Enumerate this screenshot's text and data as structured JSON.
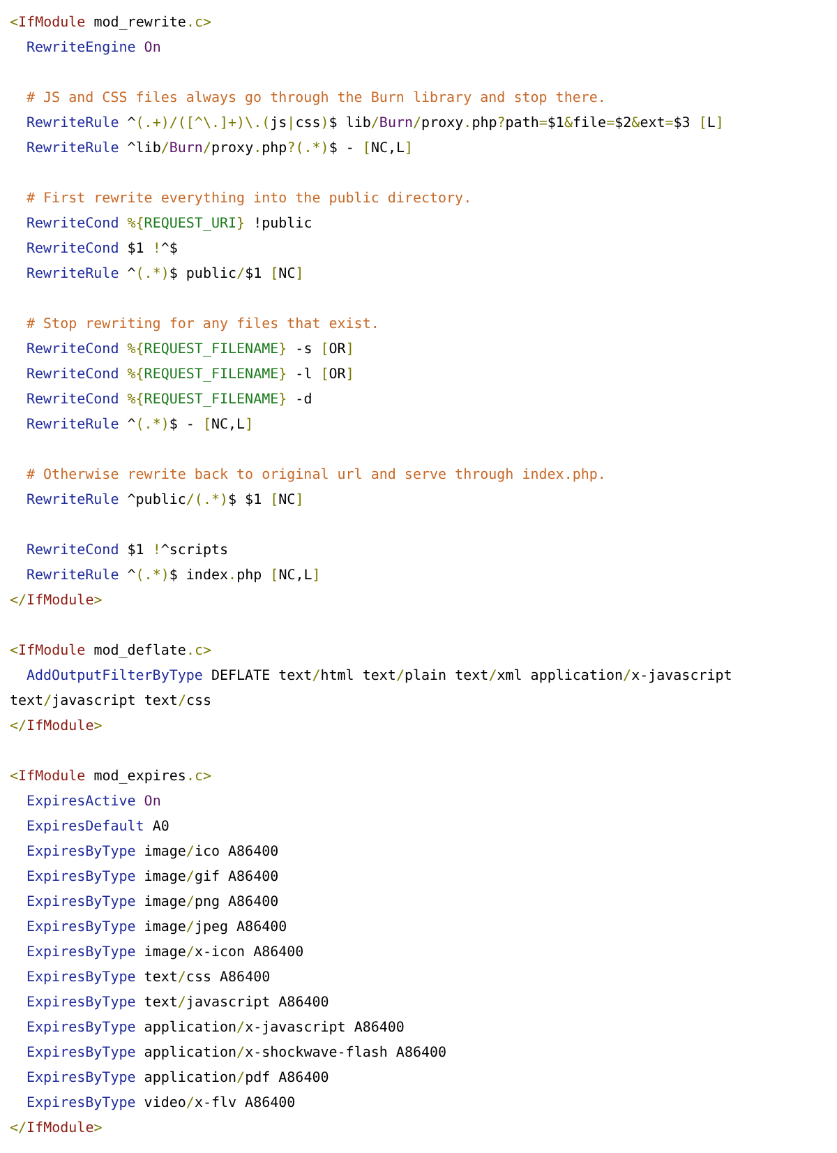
{
  "blocks": [
    {
      "open": [
        {
          "kind": "op",
          "text": "<"
        },
        {
          "kind": "tag",
          "text": "IfModule"
        },
        {
          "kind": "txt",
          "text": " mod_rewrite"
        },
        {
          "kind": "op",
          "text": ".c>"
        }
      ],
      "groups": [
        [
          [
            {
              "kind": "dir",
              "text": "RewriteEngine "
            },
            {
              "kind": "kw",
              "text": "On"
            }
          ]
        ],
        [
          [
            {
              "kind": "cmt",
              "text": "# JS and CSS files always go through the Burn library and stop there."
            }
          ],
          [
            {
              "kind": "dir",
              "text": "RewriteRule"
            },
            {
              "kind": "txt",
              "text": " ^"
            },
            {
              "kind": "op",
              "text": "(.+)/([^\\.]+)\\.("
            },
            {
              "kind": "txt",
              "text": "js"
            },
            {
              "kind": "op",
              "text": "|"
            },
            {
              "kind": "txt",
              "text": "css"
            },
            {
              "kind": "op",
              "text": ")"
            },
            {
              "kind": "txt",
              "text": "$ lib"
            },
            {
              "kind": "op",
              "text": "/"
            },
            {
              "kind": "kw",
              "text": "Burn"
            },
            {
              "kind": "op",
              "text": "/"
            },
            {
              "kind": "txt",
              "text": "proxy"
            },
            {
              "kind": "op",
              "text": "."
            },
            {
              "kind": "txt",
              "text": "php"
            },
            {
              "kind": "op",
              "text": "?"
            },
            {
              "kind": "txt",
              "text": "path"
            },
            {
              "kind": "op",
              "text": "="
            },
            {
              "kind": "txt",
              "text": "$1"
            },
            {
              "kind": "op",
              "text": "&"
            },
            {
              "kind": "txt",
              "text": "file"
            },
            {
              "kind": "op",
              "text": "="
            },
            {
              "kind": "txt",
              "text": "$2"
            },
            {
              "kind": "op",
              "text": "&"
            },
            {
              "kind": "txt",
              "text": "ext"
            },
            {
              "kind": "op",
              "text": "="
            },
            {
              "kind": "txt",
              "text": "$3 "
            },
            {
              "kind": "op",
              "text": "["
            },
            {
              "kind": "txt",
              "text": "L"
            },
            {
              "kind": "op",
              "text": "]"
            }
          ],
          [
            {
              "kind": "dir",
              "text": "RewriteRule"
            },
            {
              "kind": "txt",
              "text": " ^lib"
            },
            {
              "kind": "op",
              "text": "/"
            },
            {
              "kind": "kw",
              "text": "Burn"
            },
            {
              "kind": "op",
              "text": "/"
            },
            {
              "kind": "txt",
              "text": "proxy"
            },
            {
              "kind": "op",
              "text": "."
            },
            {
              "kind": "txt",
              "text": "php"
            },
            {
              "kind": "op",
              "text": "?(.*)"
            },
            {
              "kind": "txt",
              "text": "$ - "
            },
            {
              "kind": "op",
              "text": "["
            },
            {
              "kind": "txt",
              "text": "NC,L"
            },
            {
              "kind": "op",
              "text": "]"
            }
          ]
        ],
        [
          [
            {
              "kind": "cmt",
              "text": "# First rewrite everything into the public directory."
            }
          ],
          [
            {
              "kind": "dir",
              "text": "RewriteCond "
            },
            {
              "kind": "op",
              "text": "%{"
            },
            {
              "kind": "var",
              "text": "REQUEST_URI"
            },
            {
              "kind": "op",
              "text": "}"
            },
            {
              "kind": "txt",
              "text": " !public"
            }
          ],
          [
            {
              "kind": "dir",
              "text": "RewriteCond"
            },
            {
              "kind": "txt",
              "text": " $1 "
            },
            {
              "kind": "op",
              "text": "!"
            },
            {
              "kind": "txt",
              "text": "^$"
            }
          ],
          [
            {
              "kind": "dir",
              "text": "RewriteRule"
            },
            {
              "kind": "txt",
              "text": " ^"
            },
            {
              "kind": "op",
              "text": "(.*)"
            },
            {
              "kind": "txt",
              "text": "$ public"
            },
            {
              "kind": "op",
              "text": "/"
            },
            {
              "kind": "txt",
              "text": "$1 "
            },
            {
              "kind": "op",
              "text": "["
            },
            {
              "kind": "txt",
              "text": "NC"
            },
            {
              "kind": "op",
              "text": "]"
            }
          ]
        ],
        [
          [
            {
              "kind": "cmt",
              "text": "# Stop rewriting for any files that exist."
            }
          ],
          [
            {
              "kind": "dir",
              "text": "RewriteCond "
            },
            {
              "kind": "op",
              "text": "%{"
            },
            {
              "kind": "var",
              "text": "REQUEST_FILENAME"
            },
            {
              "kind": "op",
              "text": "}"
            },
            {
              "kind": "txt",
              "text": " -s "
            },
            {
              "kind": "op",
              "text": "["
            },
            {
              "kind": "txt",
              "text": "OR"
            },
            {
              "kind": "op",
              "text": "]"
            }
          ],
          [
            {
              "kind": "dir",
              "text": "RewriteCond "
            },
            {
              "kind": "op",
              "text": "%{"
            },
            {
              "kind": "var",
              "text": "REQUEST_FILENAME"
            },
            {
              "kind": "op",
              "text": "}"
            },
            {
              "kind": "txt",
              "text": " -l "
            },
            {
              "kind": "op",
              "text": "["
            },
            {
              "kind": "txt",
              "text": "OR"
            },
            {
              "kind": "op",
              "text": "]"
            }
          ],
          [
            {
              "kind": "dir",
              "text": "RewriteCond "
            },
            {
              "kind": "op",
              "text": "%{"
            },
            {
              "kind": "var",
              "text": "REQUEST_FILENAME"
            },
            {
              "kind": "op",
              "text": "}"
            },
            {
              "kind": "txt",
              "text": " -d"
            }
          ],
          [
            {
              "kind": "dir",
              "text": "RewriteRule"
            },
            {
              "kind": "txt",
              "text": " ^"
            },
            {
              "kind": "op",
              "text": "(.*)"
            },
            {
              "kind": "txt",
              "text": "$ - "
            },
            {
              "kind": "op",
              "text": "["
            },
            {
              "kind": "txt",
              "text": "NC,L"
            },
            {
              "kind": "op",
              "text": "]"
            }
          ]
        ],
        [
          [
            {
              "kind": "cmt",
              "text": "# Otherwise rewrite back to original url and serve through index.php."
            }
          ],
          [
            {
              "kind": "dir",
              "text": "RewriteRule"
            },
            {
              "kind": "txt",
              "text": " ^public"
            },
            {
              "kind": "op",
              "text": "/(.*)"
            },
            {
              "kind": "txt",
              "text": "$ $1 "
            },
            {
              "kind": "op",
              "text": "["
            },
            {
              "kind": "txt",
              "text": "NC"
            },
            {
              "kind": "op",
              "text": "]"
            }
          ]
        ],
        [
          [
            {
              "kind": "dir",
              "text": "RewriteCond"
            },
            {
              "kind": "txt",
              "text": " $1 "
            },
            {
              "kind": "op",
              "text": "!"
            },
            {
              "kind": "txt",
              "text": "^scripts"
            }
          ],
          [
            {
              "kind": "dir",
              "text": "RewriteRule"
            },
            {
              "kind": "txt",
              "text": " ^"
            },
            {
              "kind": "op",
              "text": "(.*)"
            },
            {
              "kind": "txt",
              "text": "$ index"
            },
            {
              "kind": "op",
              "text": "."
            },
            {
              "kind": "txt",
              "text": "php "
            },
            {
              "kind": "op",
              "text": "["
            },
            {
              "kind": "txt",
              "text": "NC,L"
            },
            {
              "kind": "op",
              "text": "]"
            }
          ]
        ]
      ],
      "close": [
        {
          "kind": "op",
          "text": "</"
        },
        {
          "kind": "tag",
          "text": "IfModule"
        },
        {
          "kind": "op",
          "text": ">"
        }
      ]
    },
    {
      "open": [
        {
          "kind": "op",
          "text": "<"
        },
        {
          "kind": "tag",
          "text": "IfModule"
        },
        {
          "kind": "txt",
          "text": " mod_deflate"
        },
        {
          "kind": "op",
          "text": ".c>"
        }
      ],
      "groups": [
        [
          [
            {
              "kind": "dir",
              "text": "AddOutputFilterByType"
            },
            {
              "kind": "txt",
              "text": " DEFLATE text"
            },
            {
              "kind": "op",
              "text": "/"
            },
            {
              "kind": "txt",
              "text": "html text"
            },
            {
              "kind": "op",
              "text": "/"
            },
            {
              "kind": "txt",
              "text": "plain text"
            },
            {
              "kind": "op",
              "text": "/"
            },
            {
              "kind": "txt",
              "text": "xml application"
            },
            {
              "kind": "op",
              "text": "/"
            },
            {
              "kind": "txt",
              "text": "x-javascript text"
            },
            {
              "kind": "op",
              "text": "/"
            },
            {
              "kind": "txt",
              "text": "javascript text"
            },
            {
              "kind": "op",
              "text": "/"
            },
            {
              "kind": "txt",
              "text": "css"
            }
          ]
        ]
      ],
      "close": [
        {
          "kind": "op",
          "text": "</"
        },
        {
          "kind": "tag",
          "text": "IfModule"
        },
        {
          "kind": "op",
          "text": ">"
        }
      ]
    },
    {
      "open": [
        {
          "kind": "op",
          "text": "<"
        },
        {
          "kind": "tag",
          "text": "IfModule"
        },
        {
          "kind": "txt",
          "text": " mod_expires"
        },
        {
          "kind": "op",
          "text": ".c>"
        }
      ],
      "groups": [
        [
          [
            {
              "kind": "dir",
              "text": "ExpiresActive "
            },
            {
              "kind": "kw",
              "text": "On"
            }
          ],
          [
            {
              "kind": "dir",
              "text": "ExpiresDefault"
            },
            {
              "kind": "txt",
              "text": " A0"
            }
          ],
          [
            {
              "kind": "dir",
              "text": "ExpiresByType"
            },
            {
              "kind": "txt",
              "text": " image"
            },
            {
              "kind": "op",
              "text": "/"
            },
            {
              "kind": "txt",
              "text": "ico A86400"
            }
          ],
          [
            {
              "kind": "dir",
              "text": "ExpiresByType"
            },
            {
              "kind": "txt",
              "text": " image"
            },
            {
              "kind": "op",
              "text": "/"
            },
            {
              "kind": "txt",
              "text": "gif A86400"
            }
          ],
          [
            {
              "kind": "dir",
              "text": "ExpiresByType"
            },
            {
              "kind": "txt",
              "text": " image"
            },
            {
              "kind": "op",
              "text": "/"
            },
            {
              "kind": "txt",
              "text": "png A86400"
            }
          ],
          [
            {
              "kind": "dir",
              "text": "ExpiresByType"
            },
            {
              "kind": "txt",
              "text": " image"
            },
            {
              "kind": "op",
              "text": "/"
            },
            {
              "kind": "txt",
              "text": "jpeg A86400"
            }
          ],
          [
            {
              "kind": "dir",
              "text": "ExpiresByType"
            },
            {
              "kind": "txt",
              "text": " image"
            },
            {
              "kind": "op",
              "text": "/"
            },
            {
              "kind": "txt",
              "text": "x-icon A86400"
            }
          ],
          [
            {
              "kind": "dir",
              "text": "ExpiresByType"
            },
            {
              "kind": "txt",
              "text": " text"
            },
            {
              "kind": "op",
              "text": "/"
            },
            {
              "kind": "txt",
              "text": "css A86400"
            }
          ],
          [
            {
              "kind": "dir",
              "text": "ExpiresByType"
            },
            {
              "kind": "txt",
              "text": " text"
            },
            {
              "kind": "op",
              "text": "/"
            },
            {
              "kind": "txt",
              "text": "javascript A86400"
            }
          ],
          [
            {
              "kind": "dir",
              "text": "ExpiresByType"
            },
            {
              "kind": "txt",
              "text": " application"
            },
            {
              "kind": "op",
              "text": "/"
            },
            {
              "kind": "txt",
              "text": "x-javascript A86400"
            }
          ],
          [
            {
              "kind": "dir",
              "text": "ExpiresByType"
            },
            {
              "kind": "txt",
              "text": " application"
            },
            {
              "kind": "op",
              "text": "/"
            },
            {
              "kind": "txt",
              "text": "x-shockwave-flash A86400"
            }
          ],
          [
            {
              "kind": "dir",
              "text": "ExpiresByType"
            },
            {
              "kind": "txt",
              "text": " application"
            },
            {
              "kind": "op",
              "text": "/"
            },
            {
              "kind": "txt",
              "text": "pdf A86400"
            }
          ],
          [
            {
              "kind": "dir",
              "text": "ExpiresByType"
            },
            {
              "kind": "txt",
              "text": " video"
            },
            {
              "kind": "op",
              "text": "/"
            },
            {
              "kind": "txt",
              "text": "x-flv A86400"
            }
          ]
        ]
      ],
      "close": [
        {
          "kind": "op",
          "text": "</"
        },
        {
          "kind": "tag",
          "text": "IfModule"
        },
        {
          "kind": "op",
          "text": ">"
        }
      ]
    }
  ]
}
